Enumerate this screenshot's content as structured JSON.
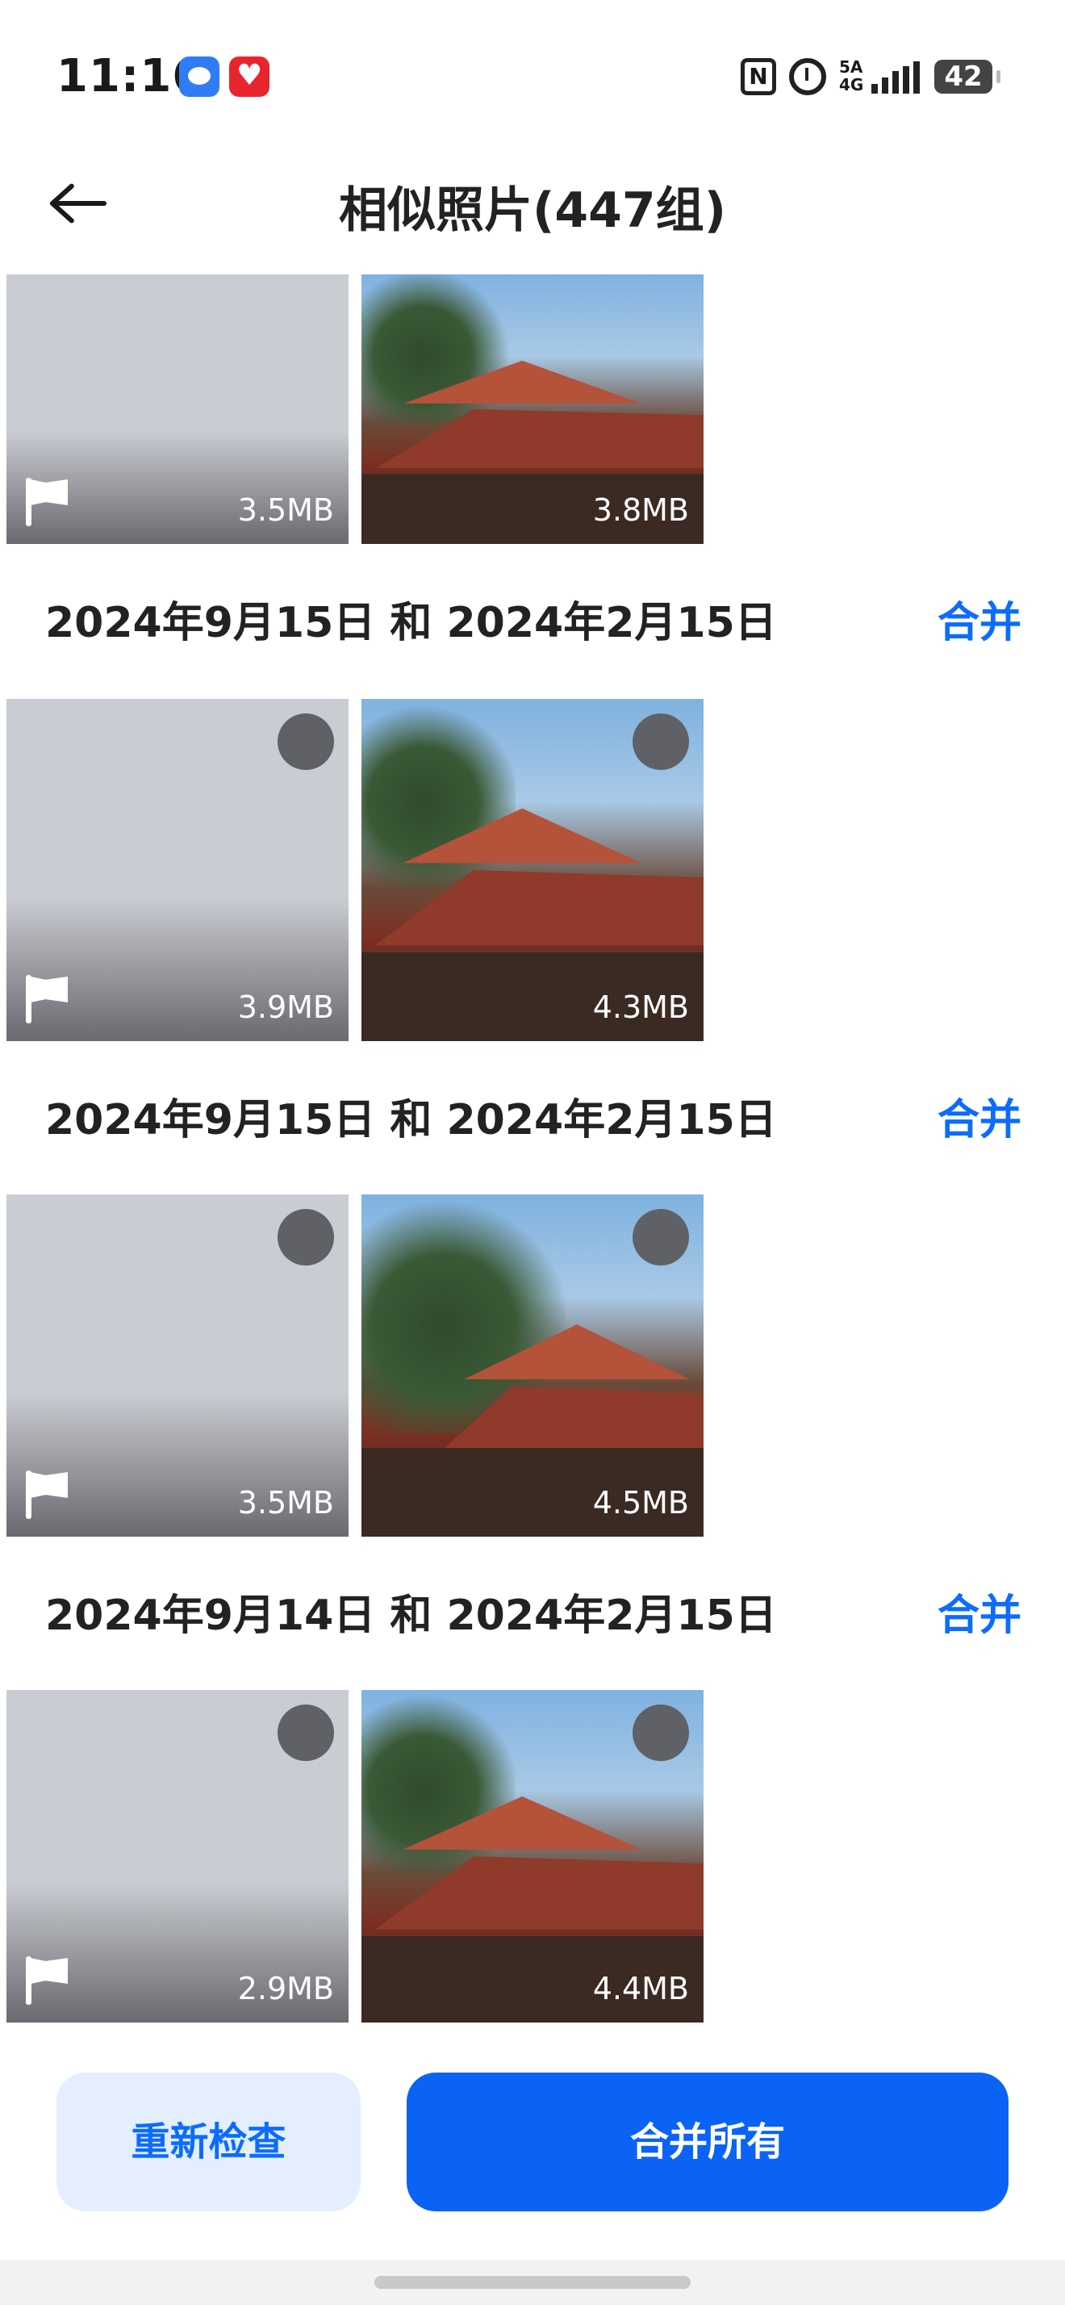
{
  "status_bar": {
    "time": "11:16",
    "network_label": "5A 4G",
    "battery": "42"
  },
  "header": {
    "title": "相似照片(447组)"
  },
  "groups": [
    {
      "date": "",
      "merge_label": "",
      "left_size": "3.5MB",
      "right_size": "3.8MB"
    },
    {
      "date": "2024年9月15日 和 2024年2月15日",
      "merge_label": "合并",
      "left_size": "3.9MB",
      "right_size": "4.3MB"
    },
    {
      "date": "2024年9月15日 和 2024年2月15日",
      "merge_label": "合并",
      "left_size": "3.5MB",
      "right_size": "4.5MB"
    },
    {
      "date": "2024年9月14日 和 2024年2月15日",
      "merge_label": "合并",
      "left_size": "2.9MB",
      "right_size": "4.4MB"
    }
  ],
  "footer": {
    "recheck_label": "重新检查",
    "merge_all_label": "合并所有"
  },
  "colors": {
    "accent": "#0b6cff",
    "primary_button": "#0b63f6",
    "secondary_button_bg": "#e3efff"
  }
}
